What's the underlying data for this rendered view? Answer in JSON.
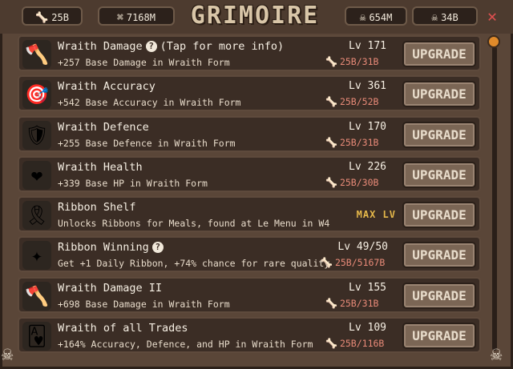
{
  "header": {
    "title": "GRIMOIRE",
    "bones_1": "25B",
    "bones_2": "7168M",
    "skulls": "654M",
    "other": "34B"
  },
  "upgrades": [
    {
      "name": "Wraith Damage",
      "help": true,
      "help_text": "(Tap for more info)",
      "desc": "+257 Base Damage in Wraith Form",
      "level": "Lv 171",
      "cost": "25B/31B",
      "button": "UPGRADE",
      "icon": "axe-icon",
      "glyph": "🪓",
      "iconbg": "#2d2620"
    },
    {
      "name": "Wraith Accuracy",
      "help": false,
      "help_text": "",
      "desc": "+542 Base Accuracy in Wraith Form",
      "level": "Lv 361",
      "cost": "25B/52B",
      "button": "UPGRADE",
      "icon": "target-icon",
      "glyph": "🎯",
      "iconbg": "#2d2620"
    },
    {
      "name": "Wraith Defence",
      "help": false,
      "help_text": "",
      "desc": "+255 Base Defence in Wraith Form",
      "level": "Lv 170",
      "cost": "25B/31B",
      "button": "UPGRADE",
      "icon": "shield-icon",
      "glyph": "🛡",
      "iconbg": "#2d2620"
    },
    {
      "name": "Wraith Health",
      "help": false,
      "help_text": "",
      "desc": "+339 Base HP in Wraith Form",
      "level": "Lv 226",
      "cost": "25B/30B",
      "button": "UPGRADE",
      "icon": "heart-icon",
      "glyph": "❤",
      "iconbg": "#2d2620"
    },
    {
      "name": "Ribbon Shelf",
      "help": false,
      "help_text": "",
      "desc": "Unlocks Ribbons for Meals, found at Le Menu in W4",
      "level": "",
      "cost": "",
      "max": "MAX LV",
      "button": "UPGRADE",
      "icon": "ribbon-icon",
      "glyph": "🎗",
      "iconbg": "#2d2620"
    },
    {
      "name": "Ribbon Winning",
      "help": true,
      "help_text": "",
      "desc": "Get +1 Daily Ribbon, +74% chance for rare quality",
      "level": "Lv 49/50",
      "cost": "25B/5167B",
      "button": "UPGRADE",
      "icon": "idol-icon",
      "glyph": "✦",
      "iconbg": "#2d2620"
    },
    {
      "name": "Wraith Damage II",
      "help": false,
      "help_text": "",
      "desc": "+698 Base Damage in Wraith Form",
      "level": "Lv 155",
      "cost": "25B/31B",
      "button": "UPGRADE",
      "icon": "axe-icon",
      "glyph": "🪓",
      "iconbg": "#2d2620"
    },
    {
      "name": "Wraith of all Trades",
      "help": false,
      "help_text": "",
      "desc": "+164% Accuracy, Defence, and HP in Wraith Form",
      "level": "Lv 109",
      "cost": "25B/116B",
      "button": "UPGRADE",
      "icon": "cards-icon",
      "glyph": "🂱",
      "iconbg": "#2d2620"
    }
  ]
}
